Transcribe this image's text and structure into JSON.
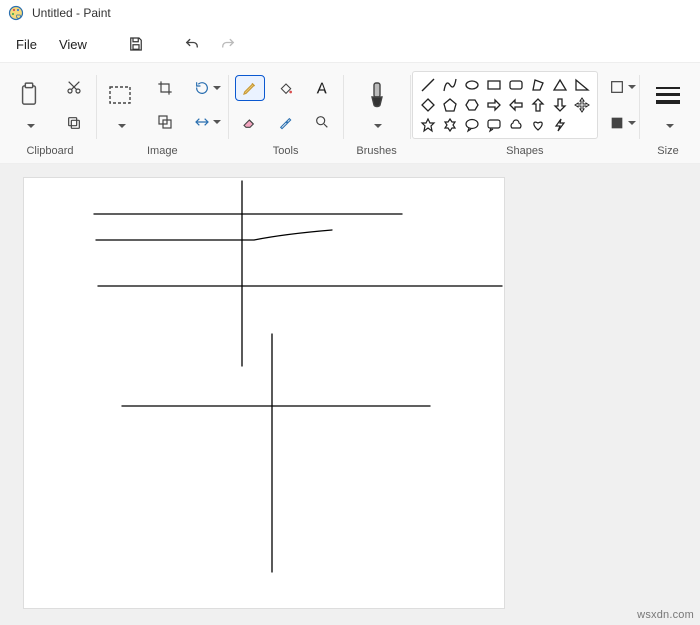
{
  "title": "Untitled - Paint",
  "menu": {
    "file": "File",
    "view": "View"
  },
  "groups": {
    "clipboard": "Clipboard",
    "image": "Image",
    "tools": "Tools",
    "brushes": "Brushes",
    "shapes": "Shapes",
    "size": "Size"
  },
  "watermark": "wsxdn.com",
  "shape_names": [
    "line",
    "curve",
    "oval",
    "rectangle",
    "rounded-rectangle",
    "polygon",
    "triangle",
    "right-triangle",
    "diamond",
    "pentagon",
    "hexagon",
    "right-arrow",
    "left-arrow",
    "up-arrow",
    "down-arrow",
    "four-arrow",
    "five-star",
    "six-star",
    "rounded-speech",
    "rect-speech",
    "cloud",
    "heart",
    "lightning",
    "blank"
  ]
}
